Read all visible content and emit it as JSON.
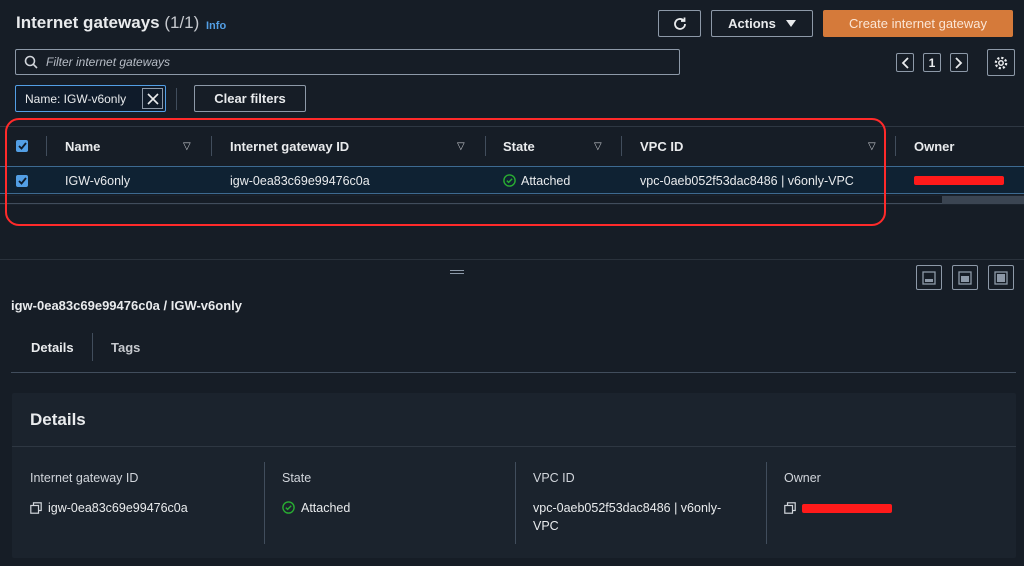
{
  "header": {
    "title": "Internet gateways",
    "count": "(1/1)",
    "info_link": "Info",
    "actions_label": "Actions",
    "create_label": "Create internet gateway"
  },
  "search": {
    "placeholder": "Filter internet gateways"
  },
  "pagination": {
    "current_page": "1"
  },
  "filters": {
    "token_label": "Name: IGW-v6only",
    "clear_label": "Clear filters"
  },
  "table": {
    "columns": [
      "Name",
      "Internet gateway ID",
      "State",
      "VPC ID",
      "Owner"
    ],
    "rows": [
      {
        "name": "IGW-v6only",
        "id": "igw-0ea83c69e99476c0a",
        "state": "Attached",
        "vpc": "vpc-0aeb052f53dac8486 | v6only-VPC",
        "owner_redacted": true
      }
    ]
  },
  "details": {
    "title": "igw-0ea83c69e99476c0a / IGW-v6only",
    "tabs": [
      "Details",
      "Tags"
    ],
    "card_title": "Details",
    "fields": {
      "id_label": "Internet gateway ID",
      "id_value": "igw-0ea83c69e99476c0a",
      "state_label": "State",
      "state_value": "Attached",
      "vpc_label": "VPC ID",
      "vpc_value": "vpc-0aeb052f53dac8486 | v6only-VPC",
      "owner_label": "Owner"
    }
  },
  "colors": {
    "accent": "#539fe5",
    "primary_button": "#d57a3a",
    "success": "#29ad32",
    "highlight": "#ff2a2a",
    "background": "#161d26"
  }
}
